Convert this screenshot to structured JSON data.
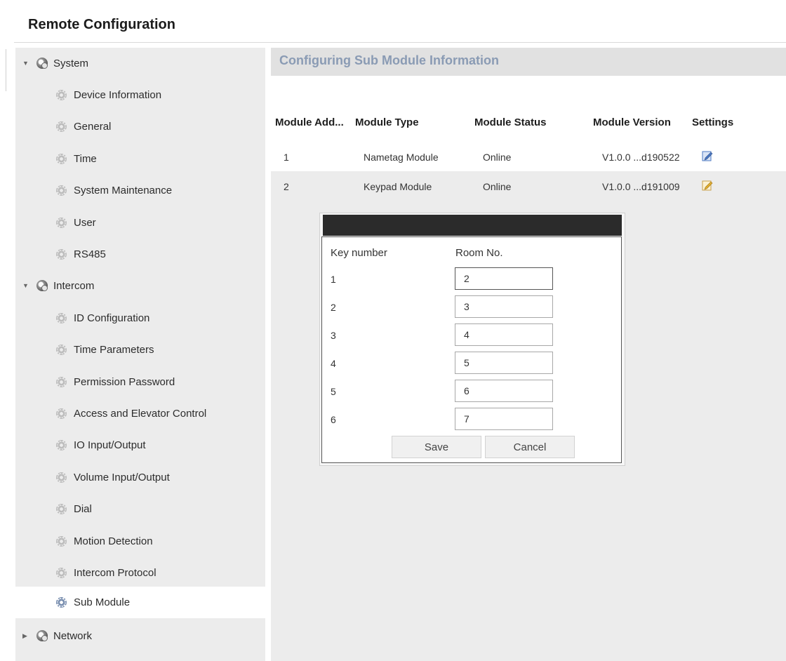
{
  "window": {
    "title": "Remote Configuration"
  },
  "sidebar": {
    "items": [
      {
        "label": "System",
        "type": "group",
        "expanded": true,
        "icon": "system-icon"
      },
      {
        "label": "Device Information",
        "type": "child",
        "icon": "gear-icon"
      },
      {
        "label": "General",
        "type": "child",
        "icon": "gear-icon"
      },
      {
        "label": "Time",
        "type": "child",
        "icon": "gear-icon"
      },
      {
        "label": "System Maintenance",
        "type": "child",
        "icon": "gear-icon"
      },
      {
        "label": "User",
        "type": "child",
        "icon": "gear-icon"
      },
      {
        "label": "RS485",
        "type": "child",
        "icon": "gear-icon"
      },
      {
        "label": "Intercom",
        "type": "group",
        "expanded": true,
        "icon": "system-icon"
      },
      {
        "label": "ID Configuration",
        "type": "child",
        "icon": "gear-icon"
      },
      {
        "label": "Time Parameters",
        "type": "child",
        "icon": "gear-icon"
      },
      {
        "label": "Permission Password",
        "type": "child",
        "icon": "gear-icon"
      },
      {
        "label": "Access and Elevator Control",
        "type": "child",
        "icon": "gear-icon"
      },
      {
        "label": "IO Input/Output",
        "type": "child",
        "icon": "gear-icon"
      },
      {
        "label": "Volume Input/Output",
        "type": "child",
        "icon": "gear-icon"
      },
      {
        "label": "Dial",
        "type": "child",
        "icon": "gear-icon"
      },
      {
        "label": "Motion Detection",
        "type": "child",
        "icon": "gear-icon"
      },
      {
        "label": "Intercom Protocol",
        "type": "child",
        "icon": "gear-icon"
      },
      {
        "label": "Sub Module",
        "type": "child",
        "icon": "gear-icon",
        "selected": true
      },
      {
        "label": "Network",
        "type": "group",
        "expanded": false,
        "icon": "system-icon"
      }
    ]
  },
  "main": {
    "title": "Configuring Sub Module Information",
    "table": {
      "headers": [
        "Module Add...",
        "Module Type",
        "Module Status",
        "Module Version",
        "Settings"
      ],
      "rows": [
        {
          "address": "1",
          "type": "Nametag Module",
          "status": "Online",
          "version": "V1.0.0 ...d190522",
          "settings_icon": "edit-icon"
        },
        {
          "address": "2",
          "type": "Keypad Module",
          "status": "Online",
          "version": "V1.0.0 ...d191009",
          "settings_icon": "edit-icon"
        }
      ]
    }
  },
  "dialog": {
    "title": "",
    "col_key": "Key number",
    "col_room": "Room No.",
    "rows": [
      {
        "key": "1",
        "room": "2"
      },
      {
        "key": "2",
        "room": "3"
      },
      {
        "key": "3",
        "room": "4"
      },
      {
        "key": "4",
        "room": "5"
      },
      {
        "key": "5",
        "room": "6"
      },
      {
        "key": "6",
        "room": "7"
      }
    ],
    "save_label": "Save",
    "cancel_label": "Cancel"
  },
  "colors": {
    "sidebar_bg": "#ececec",
    "header_title": "#8a9bb4",
    "dialog_bar": "#2b2b2b",
    "edit_icon_blue": "#4b78c2",
    "edit_icon_yellow": "#e0b030"
  }
}
